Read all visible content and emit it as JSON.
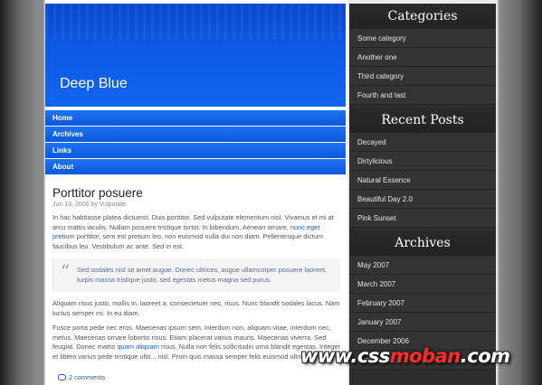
{
  "site": {
    "title": "Deep Blue"
  },
  "nav": [
    "Home",
    "Archives",
    "Links",
    "About"
  ],
  "post": {
    "title": "Porttitor posuere",
    "meta": "Jun 13, 2006 by Vulputate",
    "p1_before": "In hac habitasse platea dictumst. Duis porttitor. Sed vulputate elementum nisl. Vivamus et mi at arcu mattis iaculis. Nullam posuere tristique tortor. In bibendum. Aenean ornare, ",
    "p1_link": "nunc eget pretium",
    "p1_after": " porttitor, sem est pretium leo, non euismod nulla dui non diam. Pellentesque dictum faucibus leo. Vestibulum ac ante. Sed in est.",
    "quote": "Sed sodales nisl sit amet augue. Donec ultrices, augue ullamcorper posuere laoreet, turpis massa tristique justo, sed egestas metus magna sed purus.",
    "p2": "Aliquam risus justo, mollis in, laoreet a, consectetuer nec, risus. Nunc blandit sodales lacus. Nam luctus semper mi. In eu diam.",
    "p3_before": "Fusce porta pede nec eros. Maecenas ipsum sem, interdum non, aliquam vitae, interdum nec, metus. Maecenas ornare lobortis risus. Etiam placerat varius mauris. Maecenas viverra. Sed feugiat. Donec mattis ",
    "p3_link": "quam aliquam",
    "p3_after": " risus. Nulla non felis sollicitudin urna blandit egestas. Integer et libero varius pede tristique ultri... nisl. Proin quis massa semper felis euismod ultricies.",
    "comments": "2 comments"
  },
  "sidebar": {
    "categories_heading": "Categories",
    "categories": [
      "Some category",
      "Another one",
      "Third category",
      "Fourth and last"
    ],
    "recent_heading": "Recent Posts",
    "recent": [
      "Decayed",
      "Dirtylicious",
      "Natural Essence",
      "Beautiful Day 2.0",
      "Pink Sunset"
    ],
    "archives_heading": "Archives",
    "archives": [
      "May 2007",
      "March 2007",
      "February 2007",
      "January 2007",
      "December 2006",
      "October 2006"
    ]
  },
  "watermark": {
    "part1": "www.",
    "part2": "css",
    "part3": "moban",
    "part4": ".com"
  }
}
